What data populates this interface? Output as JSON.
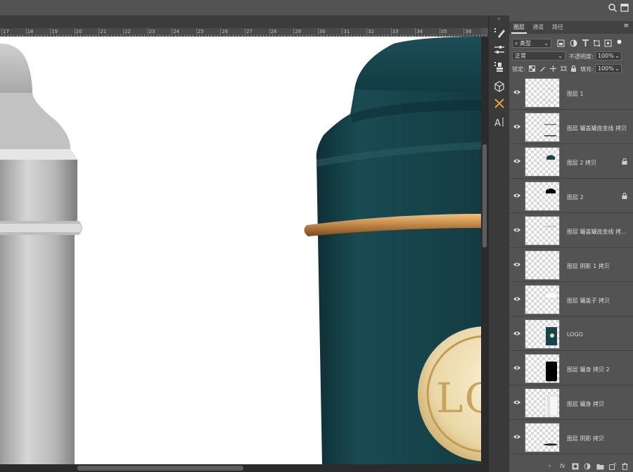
{
  "ruler": {
    "labels": [
      "17",
      "18",
      "19",
      "20",
      "21",
      "22",
      "23",
      "24",
      "25",
      "26",
      "27",
      "28",
      "29",
      "30",
      "31",
      "32",
      "33",
      "34",
      "35",
      "36"
    ]
  },
  "canvas": {
    "logo_text": "LO",
    "product_color": "#17444c",
    "band_color": "#c48a4a",
    "logo_color": "#ead7a6"
  },
  "panel": {
    "tabs": [
      {
        "label": "图层",
        "active": true
      },
      {
        "label": "通道",
        "active": false
      },
      {
        "label": "路径",
        "active": false
      }
    ],
    "filter_kind": "类型",
    "blend_mode": "正常",
    "opacity_label": "不透明度:",
    "opacity_value": "100%",
    "lock_label": "锁定:",
    "fill_label": "填充:",
    "fill_value": "100%"
  },
  "layers": [
    {
      "name": "图层 1",
      "thumb": "dots",
      "locked": false
    },
    {
      "name": "图层 罐盖罐底金线 拷贝",
      "thumb": "lines",
      "locked": false
    },
    {
      "name": "图层 2 拷贝",
      "thumb": "teal-cap",
      "locked": true
    },
    {
      "name": "图层 2",
      "thumb": "black-cap",
      "locked": true
    },
    {
      "name": "图层 罐盖罐底金线 拷...",
      "thumb": "faint-line",
      "locked": false
    },
    {
      "name": "图层 阴影 1 拷贝",
      "thumb": "empty",
      "locked": false
    },
    {
      "name": "图层 罐盖子 拷贝",
      "thumb": "white-cap",
      "locked": false
    },
    {
      "name": "LOGO",
      "thumb": "logo",
      "locked": false
    },
    {
      "name": "图层 罐身 拷贝 2",
      "thumb": "black-body",
      "locked": false
    },
    {
      "name": "图层 罐身 拷贝",
      "thumb": "white-body",
      "locked": false
    },
    {
      "name": "图层 阴影 拷贝",
      "thumb": "shadow",
      "locked": false
    }
  ],
  "bottom_bar": {
    "fx_label": "fx"
  }
}
